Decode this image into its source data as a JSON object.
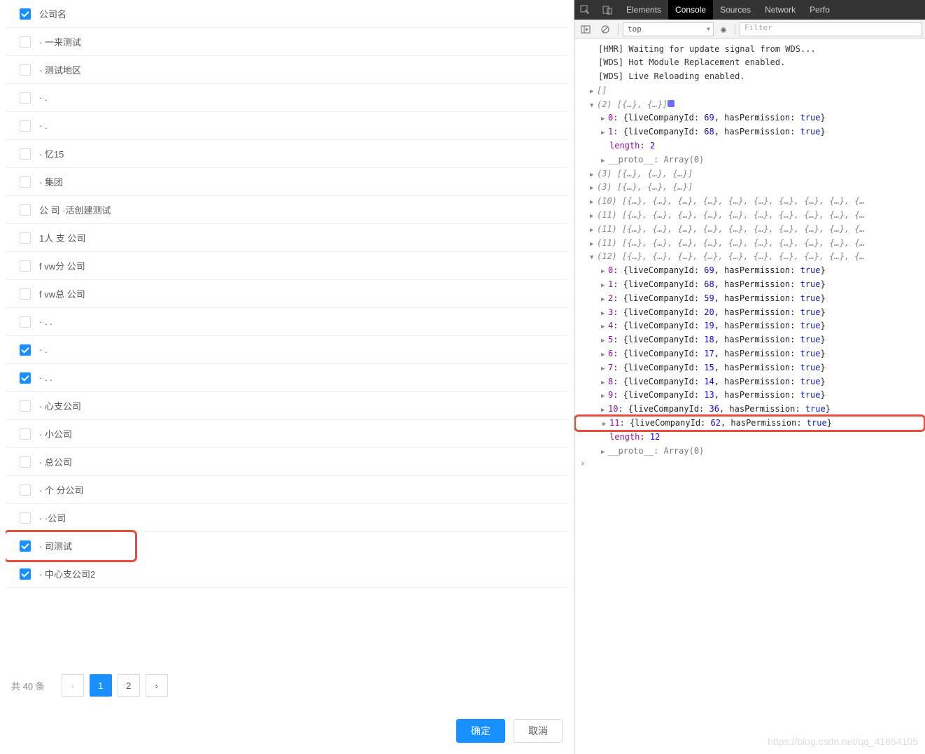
{
  "table": {
    "header": "公司名",
    "rows": [
      {
        "checked": true,
        "name": "公司名",
        "hl": false,
        "isHeader": true
      },
      {
        "checked": false,
        "name": "· 一来测试",
        "hl": false
      },
      {
        "checked": false,
        "name": "· 测试地区",
        "hl": false
      },
      {
        "checked": false,
        "name": "· . ",
        "hl": false
      },
      {
        "checked": false,
        "name": "· . ",
        "hl": false
      },
      {
        "checked": false,
        "name": "· 忆15",
        "hl": false
      },
      {
        "checked": false,
        "name": "· 集团",
        "hl": false
      },
      {
        "checked": false,
        "name": "公 司 ·活创建测试",
        "hl": false
      },
      {
        "checked": false,
        "name": "1人 支 公司",
        "hl": false
      },
      {
        "checked": false,
        "name": "f vw分 公司",
        "hl": false
      },
      {
        "checked": false,
        "name": "f vw总 公司",
        "hl": false
      },
      {
        "checked": false,
        "name": "· . .",
        "hl": false
      },
      {
        "checked": true,
        "name": "· . ",
        "hl": false
      },
      {
        "checked": true,
        "name": "· . .",
        "hl": false
      },
      {
        "checked": false,
        "name": "· ‌心支公司",
        "hl": false
      },
      {
        "checked": false,
        "name": "· 小公司",
        "hl": false
      },
      {
        "checked": false,
        "name": "· 总公司",
        "hl": false
      },
      {
        "checked": false,
        "name": "· 个 分公司",
        "hl": false
      },
      {
        "checked": false,
        "name": "· ·公司",
        "hl": false
      },
      {
        "checked": true,
        "name": "· 司测试",
        "hl": true
      },
      {
        "checked": true,
        "name": "·  中心支公司2",
        "hl": false
      }
    ]
  },
  "pagination": {
    "total_label": "共 40 条",
    "pages": [
      "1",
      "2"
    ],
    "active": 1
  },
  "footer": {
    "ok": "确定",
    "cancel": "取消"
  },
  "devtools": {
    "tabs": [
      "Elements",
      "Console",
      "Sources",
      "Network",
      "Perfo"
    ],
    "active_tab": 1,
    "context": "top",
    "filter_placeholder": "Filter",
    "messages": [
      "[HMR] Waiting for update signal from WDS...",
      "[WDS] Hot Module Replacement enabled.",
      "[WDS] Live Reloading enabled."
    ],
    "array2": {
      "label": "(2)",
      "preview": "[{…}, {…}]",
      "items": [
        {
          "idx": 0,
          "liveCompanyId": 69,
          "hasPermission": true
        },
        {
          "idx": 1,
          "liveCompanyId": 68,
          "hasPermission": true
        }
      ],
      "length": 2
    },
    "collapsed": [
      {
        "label": "(3)",
        "preview": "[{…}, {…}, {…}]"
      },
      {
        "label": "(3)",
        "preview": "[{…}, {…}, {…}]"
      },
      {
        "label": "(10)",
        "preview": "[{…}, {…}, {…}, {…}, {…}, {…}, {…}, {…}, {…}, {…"
      },
      {
        "label": "(11)",
        "preview": "[{…}, {…}, {…}, {…}, {…}, {…}, {…}, {…}, {…}, {…"
      },
      {
        "label": "(11)",
        "preview": "[{…}, {…}, {…}, {…}, {…}, {…}, {…}, {…}, {…}, {…"
      },
      {
        "label": "(11)",
        "preview": "[{…}, {…}, {…}, {…}, {…}, {…}, {…}, {…}, {…}, {…"
      }
    ],
    "array12": {
      "label": "(12)",
      "preview": "[{…}, {…}, {…}, {…}, {…}, {…}, {…}, {…}, {…}, {…",
      "items": [
        {
          "idx": 0,
          "liveCompanyId": 69,
          "hasPermission": true
        },
        {
          "idx": 1,
          "liveCompanyId": 68,
          "hasPermission": true
        },
        {
          "idx": 2,
          "liveCompanyId": 59,
          "hasPermission": true
        },
        {
          "idx": 3,
          "liveCompanyId": 20,
          "hasPermission": true
        },
        {
          "idx": 4,
          "liveCompanyId": 19,
          "hasPermission": true
        },
        {
          "idx": 5,
          "liveCompanyId": 18,
          "hasPermission": true
        },
        {
          "idx": 6,
          "liveCompanyId": 17,
          "hasPermission": true
        },
        {
          "idx": 7,
          "liveCompanyId": 15,
          "hasPermission": true
        },
        {
          "idx": 8,
          "liveCompanyId": 14,
          "hasPermission": true
        },
        {
          "idx": 9,
          "liveCompanyId": 13,
          "hasPermission": true
        },
        {
          "idx": 10,
          "liveCompanyId": 36,
          "hasPermission": true
        },
        {
          "idx": 11,
          "liveCompanyId": 62,
          "hasPermission": true,
          "hl": true
        }
      ],
      "length": 12
    },
    "proto": "__proto__: Array(0)"
  },
  "watermark": "https://blog.csdn.net/qq_41654105"
}
